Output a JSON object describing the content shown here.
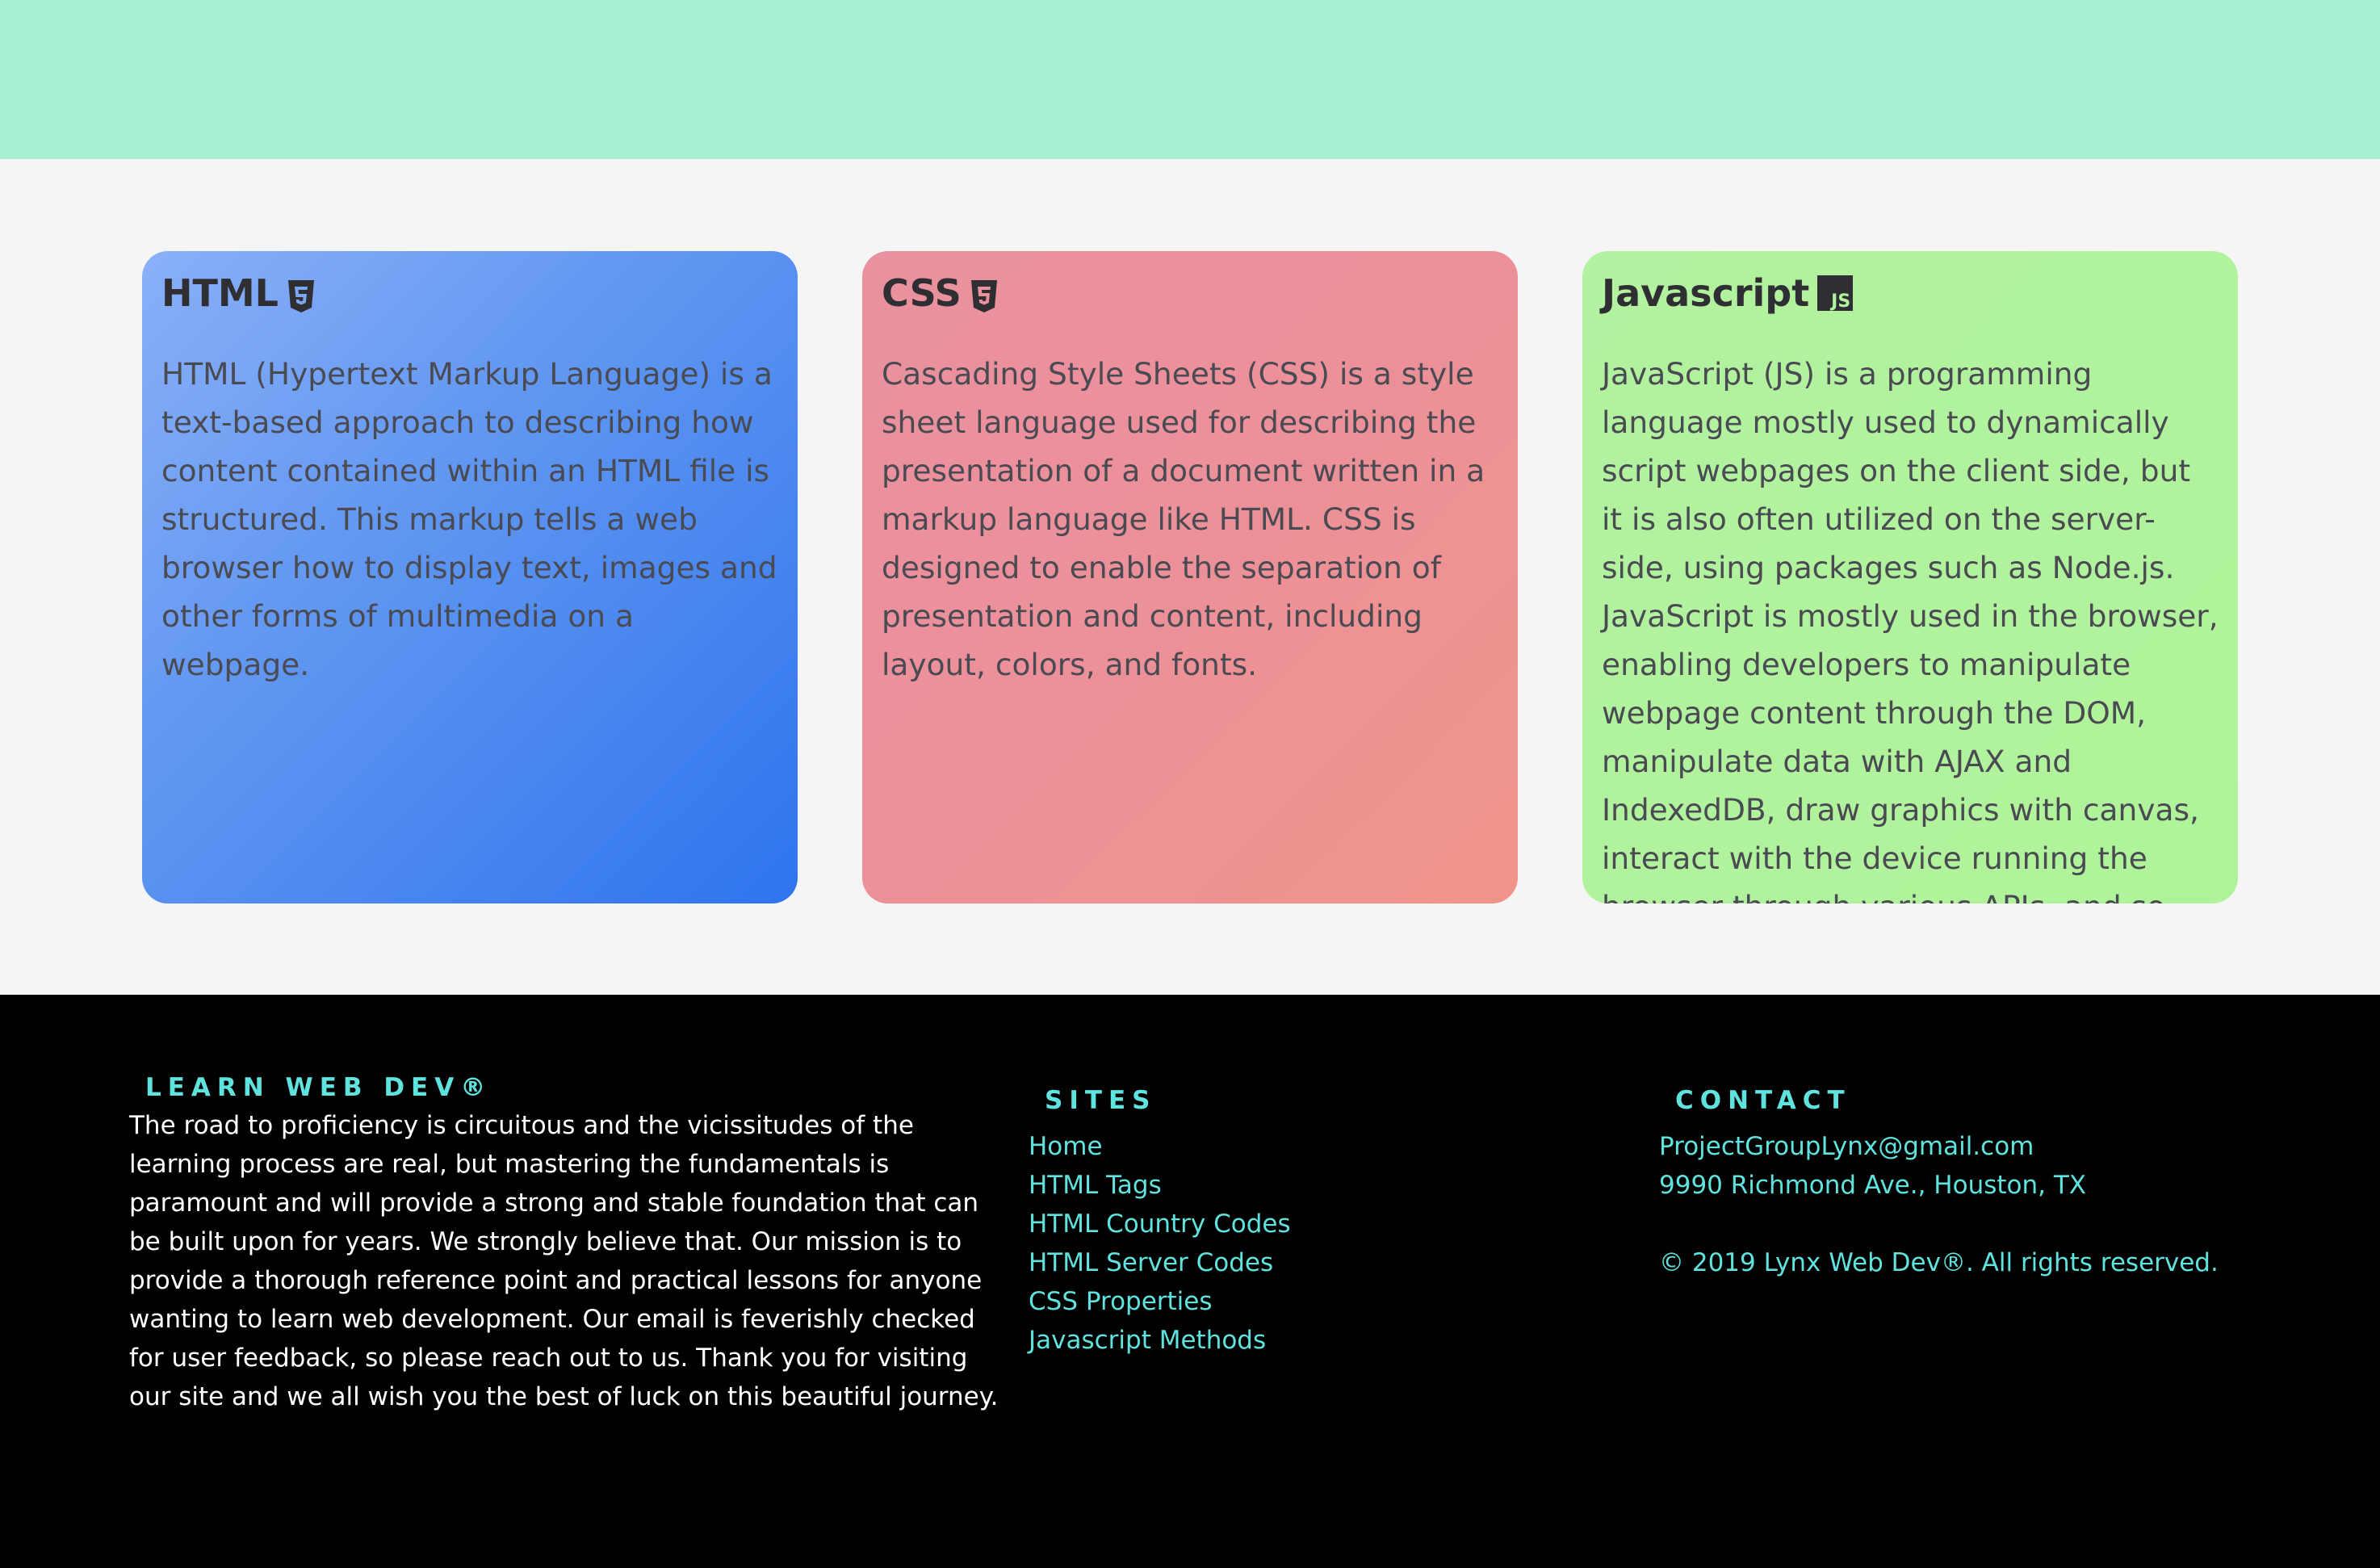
{
  "cards": [
    {
      "title": "HTML",
      "icon": "html5-icon",
      "text": "HTML (Hypertext Markup Language) is a text-based approach to describing how content contained within an HTML file is structured. This markup tells a web browser how to display text, images and other forms of multimedia on a webpage."
    },
    {
      "title": "CSS",
      "icon": "css3-icon",
      "text": "Cascading Style Sheets (CSS) is a style sheet language used for describing the presentation of a document written in a markup language like HTML. CSS is designed to enable the separation of presentation and content, including layout, colors, and fonts."
    },
    {
      "title": "Javascript",
      "icon": "js-icon",
      "icon_text": "JS",
      "text": "JavaScript (JS) is a programming language mostly used to dynamically script webpages on the client side, but it is also often utilized on the server-side, using packages such as Node.js. JavaScript is mostly used in the browser, enabling developers to manipulate webpage content through the DOM, manipulate data with AJAX and IndexedDB, draw graphics with canvas, interact with the device running the browser through various APIs, and so forth.."
    }
  ],
  "footer": {
    "about": {
      "heading": "LEARN WEB DEV®",
      "text": "The road to proficiency is circuitous and the vicissitudes of the learning process are real, but mastering the fundamentals is paramount and will provide a strong and stable foundation that can be built upon for years. We strongly believe that. Our mission is to provide a thorough reference point and practical lessons for anyone wanting to learn web development. Our email is feverishly checked for user feedback, so please reach out to us. Thank you for visiting our site and we all wish you the best of luck on this beautiful journey."
    },
    "sites": {
      "heading": "SITES",
      "links": [
        "Home",
        "HTML Tags",
        "HTML Country Codes",
        "HTML Server Codes",
        "CSS Properties",
        "Javascript Methods"
      ]
    },
    "contact": {
      "heading": "CONTACT",
      "email": "ProjectGroupLynx@gmail.com",
      "address": "9990 Richmond Ave., Houston, TX",
      "copyright": "© 2019 Lynx Web Dev®. All rights reserved."
    }
  },
  "colors": {
    "topbar": "#a8f0d2",
    "footer_accent": "#5fe3df"
  }
}
